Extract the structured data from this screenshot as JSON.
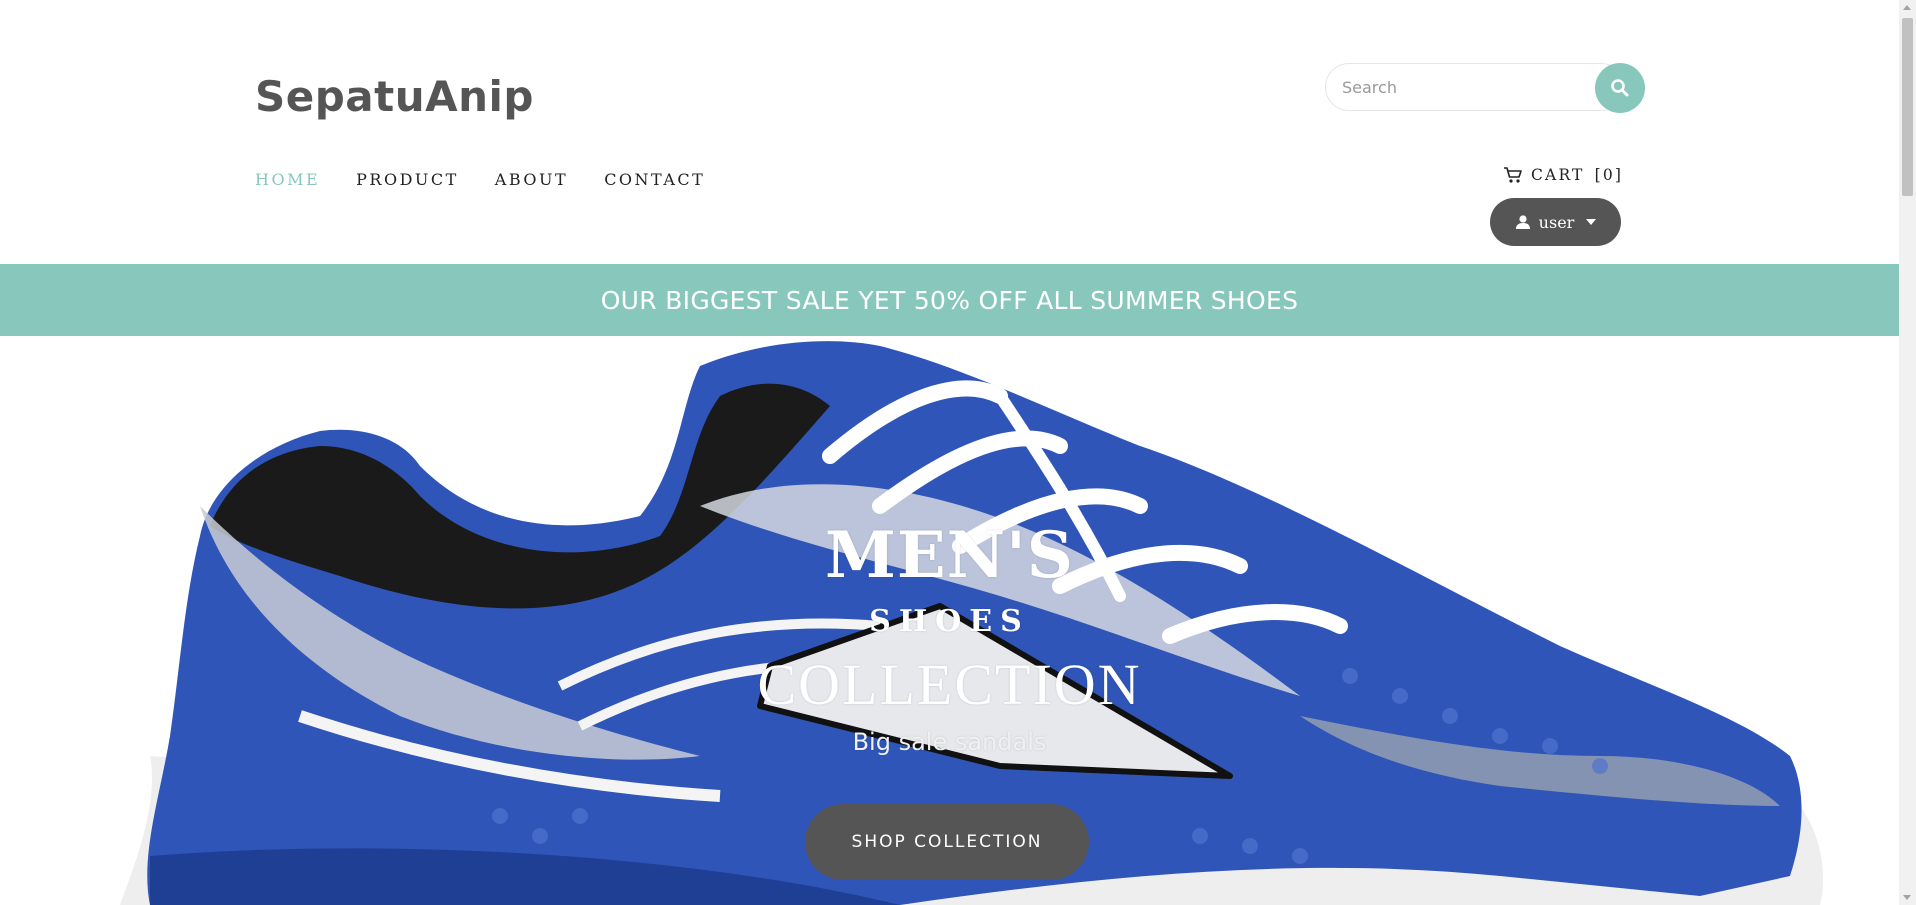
{
  "header": {
    "brand": "SepatuAnip",
    "search": {
      "placeholder": "Search",
      "value": "",
      "button_icon": "search-icon"
    },
    "nav": [
      {
        "label": "HOME",
        "active": true
      },
      {
        "label": "PRODUCT",
        "active": false
      },
      {
        "label": "ABOUT",
        "active": false
      },
      {
        "label": "CONTACT",
        "active": false
      }
    ],
    "cart": {
      "icon": "cart-icon",
      "label": "CART",
      "count": "[0]"
    },
    "user_menu": {
      "icon": "user-icon",
      "label": "user",
      "caret_icon": "caret-down-icon"
    }
  },
  "promo": {
    "text": "OUR BIGGEST SALE YET 50% OFF ALL SUMMER SHOES"
  },
  "hero": {
    "title": "MEN'S",
    "subtitle": "SHOES",
    "heading": "COLLECTION",
    "tagline": "Big sale sandals",
    "cta": "SHOP COLLECTION"
  },
  "colors": {
    "accent": "#88c8bc",
    "dark_button": "#555555",
    "brand_text": "#555555",
    "shoe_blue": "#2f55b8"
  }
}
